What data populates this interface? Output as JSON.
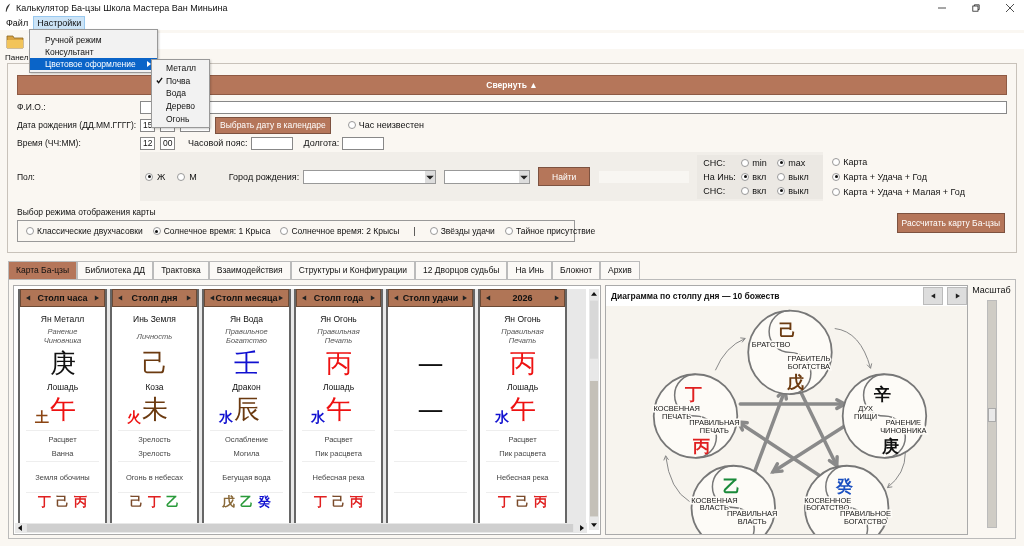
{
  "window": {
    "title": "Калькулятор Ба-цзы Школа Мастера Ван Миньина"
  },
  "menu": [
    {
      "label": "Файл",
      "selected": false
    },
    {
      "label": "Настройки",
      "selected": true
    }
  ],
  "dropdown": [
    {
      "label": "Ручной режим",
      "selected": false,
      "submenu": false
    },
    {
      "label": "Консультант",
      "selected": false,
      "submenu": false
    },
    {
      "label": "Цветовое оформление",
      "selected": true,
      "submenu": true
    }
  ],
  "submenu": [
    {
      "label": "Металл",
      "checked": false
    },
    {
      "label": "Почва",
      "checked": true
    },
    {
      "label": "Вода",
      "checked": false
    },
    {
      "label": "Дерево",
      "checked": false
    },
    {
      "label": "Огонь",
      "checked": false
    }
  ],
  "panel_label": "Панел",
  "collapse_button": "Свернуть ▲",
  "form": {
    "fio_label": "Ф.И.О.:",
    "date_label": "Дата рождения (ДД.ММ.ГГГГ):",
    "day": "15",
    "calendar_button": "Выбрать дату в календаре",
    "hour_unknown": {
      "label": "Час неизвестен",
      "checked": false
    },
    "time_label": "Время (ЧЧ:ММ):",
    "hour": "12",
    "minute": "00",
    "tz_label": "Часовой пояс:",
    "lon_label": "Долгота:",
    "gender_label": "Пол:",
    "gender": [
      {
        "label": "Ж",
        "selected": true
      },
      {
        "label": "М",
        "selected": false
      }
    ],
    "city_label": "Город рождения:",
    "find_button": "Найти",
    "options": [
      {
        "label": "СНС:",
        "choices": [
          {
            "label": "min",
            "selected": false
          },
          {
            "label": "max",
            "selected": true
          }
        ]
      },
      {
        "label": "На Инь:",
        "choices": [
          {
            "label": "вкл",
            "selected": true
          },
          {
            "label": "выкл",
            "selected": false
          }
        ]
      },
      {
        "label": "СНС:",
        "choices": [
          {
            "label": "вкл",
            "selected": false
          },
          {
            "label": "выкл",
            "selected": true
          }
        ]
      }
    ],
    "chart_types": [
      {
        "label": "Карта",
        "selected": false
      },
      {
        "label": "Карта + Удача + Год",
        "selected": true
      },
      {
        "label": "Карта + Удача + Малая + Год",
        "selected": false
      }
    ],
    "mode_label": "Выбор режима отображения карты",
    "modes": [
      {
        "kind": "radio",
        "label": "Классические двухчасовки",
        "selected": false
      },
      {
        "kind": "radio",
        "label": "Солнечное время: 1 Крыса",
        "selected": true
      },
      {
        "kind": "radio",
        "label": "Солнечное время: 2 Крысы",
        "selected": false
      },
      {
        "kind": "separator",
        "label": "|"
      },
      {
        "kind": "radio",
        "label": "Звёзды удачи",
        "selected": false
      },
      {
        "kind": "radio",
        "label": "Тайное присутствие",
        "selected": false
      }
    ],
    "calc_button": "Рассчитать карту Ба-цзы"
  },
  "tabs": [
    {
      "label": "Карта Ба-цзы",
      "selected": true
    },
    {
      "label": "Библиотека ДД",
      "selected": false
    },
    {
      "label": "Трактовка",
      "selected": false
    },
    {
      "label": "Взаимодействия",
      "selected": false
    },
    {
      "label": "Структуры и Конфигурации",
      "selected": false
    },
    {
      "label": "12 Дворцов судьбы",
      "selected": false
    },
    {
      "label": "На Инь",
      "selected": false
    },
    {
      "label": "Блокнот",
      "selected": false
    },
    {
      "label": "Архив",
      "selected": false
    }
  ],
  "pillars": [
    {
      "header": "Столп часа",
      "stem_label": "Ян Металл",
      "god": "Ранение Чиновника",
      "stem": {
        "char": "庚",
        "color": "#111111"
      },
      "animal": "Лошадь",
      "element": {
        "char": "土",
        "color": "#8b4513"
      },
      "branch": {
        "char": "午",
        "color": "#ee1111"
      },
      "phases": [
        "Расцвет",
        "Ванна"
      ],
      "nayin": "Земля обочины",
      "hidden": [
        {
          "char": "丁",
          "color": "#e02020"
        },
        {
          "char": "己",
          "color": "#7a4a2a"
        },
        {
          "char": "丙",
          "color": "#e02020"
        }
      ]
    },
    {
      "header": "Столп дня",
      "stem_label": "Инь Земля",
      "god": "Личность",
      "stem": {
        "char": "己",
        "color": "#6b3a10"
      },
      "animal": "Коза",
      "element": {
        "char": "火",
        "color": "#ee1111"
      },
      "branch": {
        "char": "未",
        "color": "#6b3a10"
      },
      "phases": [
        "Зрелость",
        "Зрелость"
      ],
      "nayin": "Огонь в небесах",
      "hidden": [
        {
          "char": "己",
          "color": "#7a4a2a"
        },
        {
          "char": "丁",
          "color": "#e02020"
        },
        {
          "char": "乙",
          "color": "#2a9a3a"
        }
      ]
    },
    {
      "header": "Столп месяца",
      "stem_label": "Ян Вода",
      "god": "Правильное Богатство",
      "stem": {
        "char": "壬",
        "color": "#1010d0"
      },
      "animal": "Дракон",
      "element": {
        "char": "水",
        "color": "#1010d0"
      },
      "branch": {
        "char": "辰",
        "color": "#6b3a10"
      },
      "phases": [
        "Ослабление",
        "Могила"
      ],
      "nayin": "Бегущая вода",
      "hidden": [
        {
          "char": "戊",
          "color": "#8a6a3a"
        },
        {
          "char": "乙",
          "color": "#2a9a3a"
        },
        {
          "char": "癸",
          "color": "#1010d0"
        }
      ]
    },
    {
      "header": "Столп года",
      "stem_label": "Ян Огонь",
      "god": "Правильная Печать",
      "stem": {
        "char": "丙",
        "color": "#ee1111"
      },
      "animal": "Лошадь",
      "element": {
        "char": "水",
        "color": "#1010d0"
      },
      "branch": {
        "char": "午",
        "color": "#ee1111"
      },
      "phases": [
        "Расцвет",
        "Пик расцвета"
      ],
      "nayin": "Небесная река",
      "hidden": [
        {
          "char": "丁",
          "color": "#e02020"
        },
        {
          "char": "己",
          "color": "#7a4a2a"
        },
        {
          "char": "丙",
          "color": "#e02020"
        }
      ]
    },
    {
      "header": "Столп удачи",
      "stem": {
        "char": "—",
        "color": "#111111"
      },
      "branch": {
        "char": "—",
        "color": "#111111"
      }
    },
    {
      "header": "2026",
      "stem_label": "Ян Огонь",
      "god": "Правильная Печать",
      "stem": {
        "char": "丙",
        "color": "#ee1111"
      },
      "animal": "Лошадь",
      "element": {
        "char": "水",
        "color": "#1010d0"
      },
      "branch": {
        "char": "午",
        "color": "#ee1111"
      },
      "phases": [
        "Расцвет",
        "Пик расцвета"
      ],
      "nayin": "Небесная река",
      "hidden": [
        {
          "char": "丁",
          "color": "#e02020"
        },
        {
          "char": "己",
          "color": "#7a4a2a"
        },
        {
          "char": "丙",
          "color": "#e02020"
        }
      ]
    }
  ],
  "diagram": {
    "title": "Диаграмма по столпу дня — 10 божеств",
    "nodes": [
      {
        "upper": {
          "char": "己",
          "color": "#6b3a10"
        },
        "label_upper": [
          "БРАТСТВО"
        ],
        "label_lower": [
          "ГРАБИТЕЛЬ",
          "БОГАТСТВА"
        ],
        "lower": {
          "char": "戊",
          "color": "#6b3a10"
        }
      },
      {
        "upper": {
          "char": "丁",
          "color": "#e02020"
        },
        "label_upper": [
          "КОСВЕННАЯ",
          "ПЕЧАТЬ"
        ],
        "label_lower": [
          "ПРАВИЛЬНАЯ",
          "ПЕЧАТЬ"
        ],
        "lower": {
          "char": "丙",
          "color": "#e02020"
        }
      },
      {
        "upper": {
          "char": "辛",
          "color": "#111111"
        },
        "label_upper": [
          "ДУХ",
          "ПИЩИ"
        ],
        "label_lower": [
          "РАНЕНИЕ",
          "ЧИНОВНИКА"
        ],
        "lower": {
          "char": "庚",
          "color": "#111111"
        }
      },
      {
        "upper": {
          "char": "乙",
          "color": "#1a8a3a"
        },
        "label_upper": [
          "КОСВЕННАЯ",
          "ВЛАСТЬ"
        ],
        "label_lower": [
          "ПРАВИЛЬНАЯ",
          "ВЛАСТЬ"
        ]
      },
      {
        "upper": {
          "char": "癸",
          "color": "#1a4fc0"
        },
        "label_upper": [
          "КОСВЕННОЕ",
          "БОГАТСТВО"
        ],
        "label_lower": [
          "ПРАВИЛЬНОЕ",
          "БОГАТСТВО"
        ]
      }
    ]
  },
  "scale": {
    "label": "Масштаб",
    "level": 0.5
  }
}
